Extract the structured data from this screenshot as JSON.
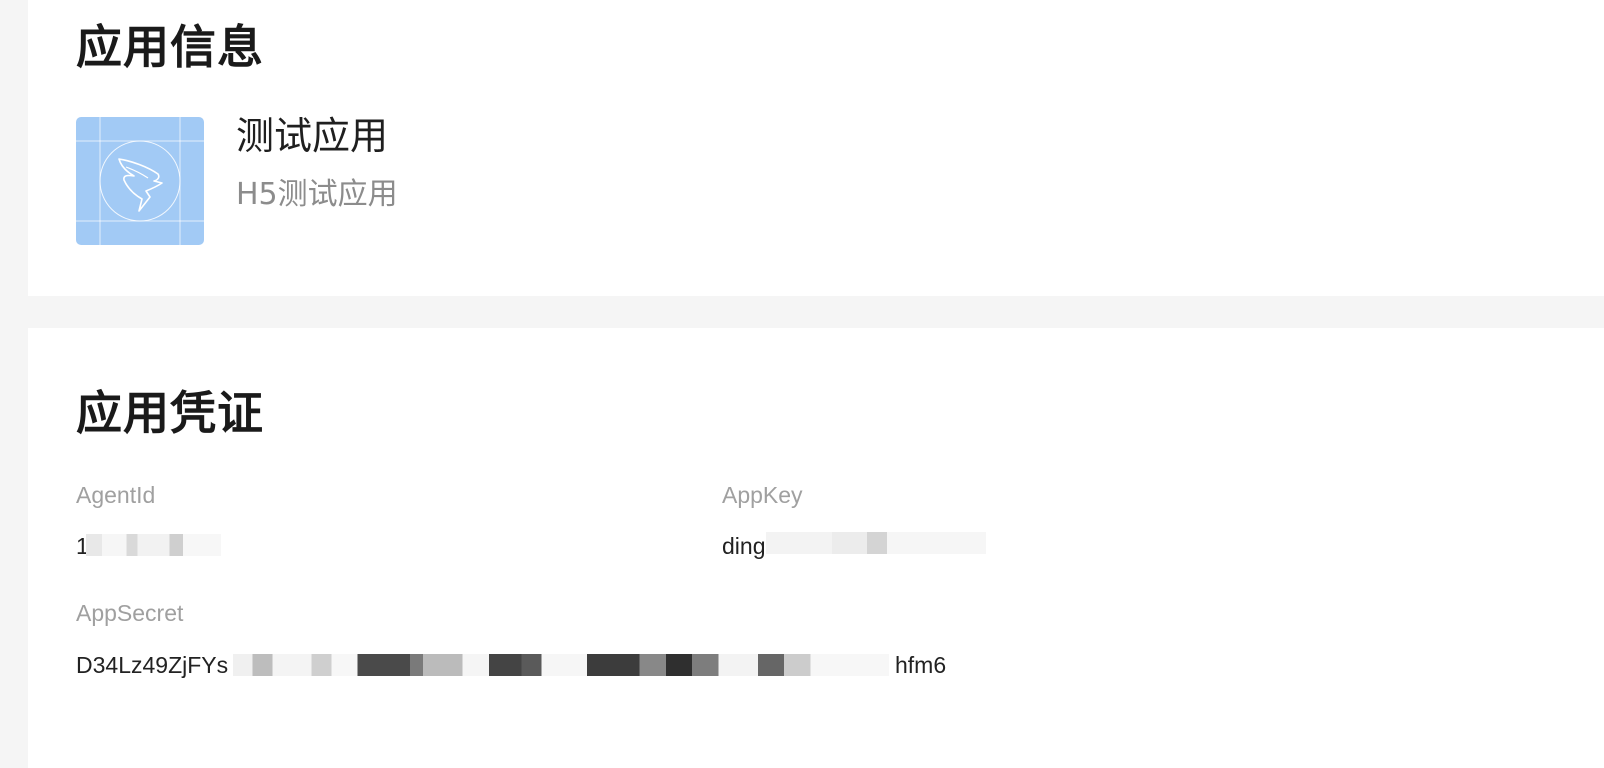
{
  "app_info": {
    "section_title": "应用信息",
    "icon": "dingtalk-app-icon",
    "app_name": "测试应用",
    "app_desc": "H5测试应用"
  },
  "credentials": {
    "section_title": "应用凭证",
    "agent_id": {
      "label": "AgentId",
      "value": "1"
    },
    "app_key": {
      "label": "AppKey",
      "value": "ding"
    },
    "app_secret": {
      "label": "AppSecret",
      "value_prefix": "D34Lz49ZjFYs",
      "value_suffix": "hfm6"
    }
  },
  "colors": {
    "page_bg": "#f5f5f5",
    "card_bg": "#ffffff",
    "icon_bg": "#a2caf5",
    "label": "#a0a0a0",
    "text": "#1f1f1f"
  }
}
